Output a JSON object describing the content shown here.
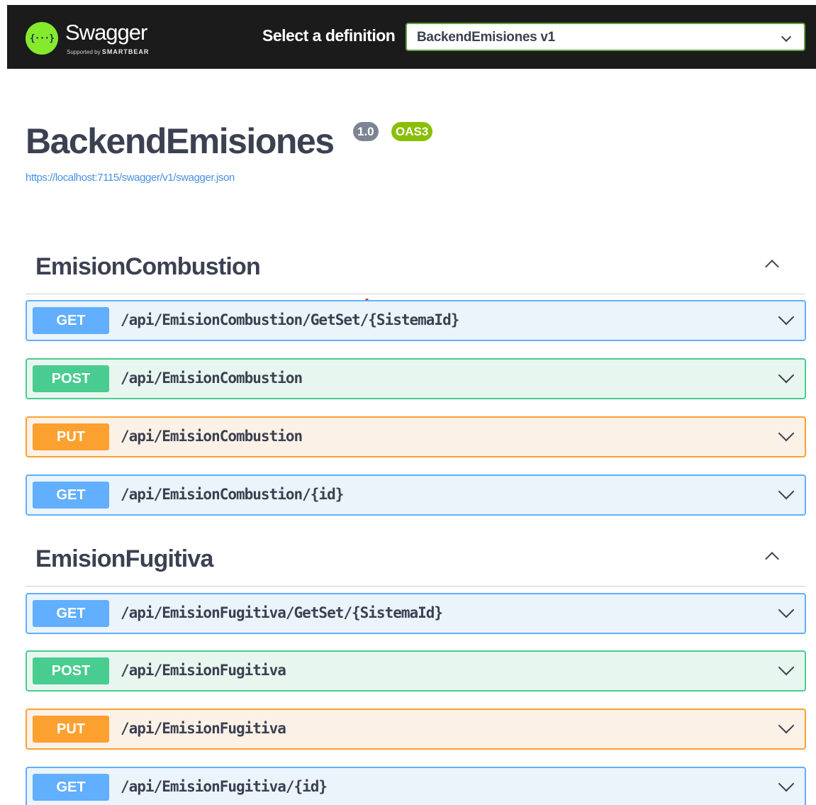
{
  "topbar": {
    "logo": {
      "name": "Swagger",
      "icon_text": "{···}",
      "supported_by": "Supported by",
      "brand": "SMARTBEAR",
      "brand_color": "#85ea2d"
    },
    "select_label": "Select a definition",
    "selected_definition": "BackendEmisiones v1"
  },
  "info": {
    "title": "BackendEmisiones",
    "version_badge": "1.0",
    "oas_badge": "OAS3",
    "spec_url": "https://localhost:7115/swagger/v1/swagger.json"
  },
  "colors": {
    "get": "#61affe",
    "post": "#49cc90",
    "put": "#fca130"
  },
  "sections": [
    {
      "name": "EmisionCombustion",
      "operations": [
        {
          "method": "GET",
          "path": "/api/EmisionCombustion/GetSet/{SistemaId}"
        },
        {
          "method": "POST",
          "path": "/api/EmisionCombustion"
        },
        {
          "method": "PUT",
          "path": "/api/EmisionCombustion"
        },
        {
          "method": "GET",
          "path": "/api/EmisionCombustion/{id}"
        }
      ]
    },
    {
      "name": "EmisionFugitiva",
      "operations": [
        {
          "method": "GET",
          "path": "/api/EmisionFugitiva/GetSet/{SistemaId}"
        },
        {
          "method": "POST",
          "path": "/api/EmisionFugitiva"
        },
        {
          "method": "PUT",
          "path": "/api/EmisionFugitiva"
        },
        {
          "method": "GET",
          "path": "/api/EmisionFugitiva/{id}"
        }
      ]
    }
  ]
}
